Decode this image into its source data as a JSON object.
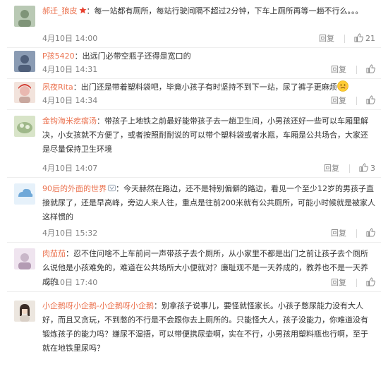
{
  "actions": {
    "reply": "回复"
  },
  "comments": [
    {
      "user": "郝迁_狼皮",
      "text": "每一站都有厕所，每站行驶间隔不超过2分钟，下车上厕所再等一趟不行么。。。",
      "date": "4月10日 14:00",
      "likes": "21",
      "avatar_color": "#b9c9b4",
      "badge": "red-star"
    },
    {
      "user": "P孩5420",
      "text": "出远门必带空瓶子还得是宽口的",
      "date": "4月10日 14:31",
      "likes": "",
      "avatar_color": "#8a9bb3"
    },
    {
      "user": "夙夜Rita",
      "text": "出门还是带着塑料袋吧，毕竟小孩子有时坚持不到下一站，尿了裤子更麻烦",
      "date": "4月10日 14:34",
      "likes": "",
      "avatar_color": "#e9b8b0",
      "emoji": "awkward-face"
    },
    {
      "user": "金钩海米疙瘩汤",
      "text": "带孩子上地铁之前最好能带孩子去一趟卫生间，小男孩还好一些可以车厢里解决，小女孩就不方便了，或者按照耐耐说的可以带个塑料袋或者水瓶，车厢是公共场合，大家还是尽量保持卫生环境",
      "date": "4月10日 14:07",
      "likes": "3",
      "avatar_color": "#9fb88a"
    },
    {
      "user": "90后的外面的世界",
      "text": "今天赫然在路边，还不是特别偏僻的路边，看见一个至少12岁的男孩子直接就尿了，还是早高峰，旁边人来人往，重点是往前200米就有公共厕所，可能小时候就是被家人这样惯的",
      "date": "4月10日 15:32",
      "likes": "",
      "avatar_color": "#6fa8d8",
      "badge": "vip-level"
    },
    {
      "user": "肉茄茄",
      "text": "忍不住问啥不上车前问一声带孩子去个厕所，从小家里不都是出门之前让孩子去个厕所么说他是小孩难免的，难道在公共场所大小便就对？廉耻观不是一天养成的，教养也不是一天养成的",
      "date": "4月10日 17:40",
      "likes": "",
      "avatar_color": "#c9b7c9"
    },
    {
      "user": "小企鹅呀小企鹅-小企鹅呀小企鹅",
      "text": "别拿孩子说事儿，要怪就怪家长。小孩子憋尿能力没有大人好，而且又贪玩，不到憋的不行是不会跟你去上厕所的。只能怪大人，孩子没能力，你难道没有锻炼孩子的能力吗？嫌尿不湿捂，可以带便携尿壶啊，实在不行，小男孩用塑料瓶也行啊，至于就在地铁里尿吗？",
      "date": "",
      "likes": "",
      "avatar_color": "#d9cfc6"
    }
  ]
}
